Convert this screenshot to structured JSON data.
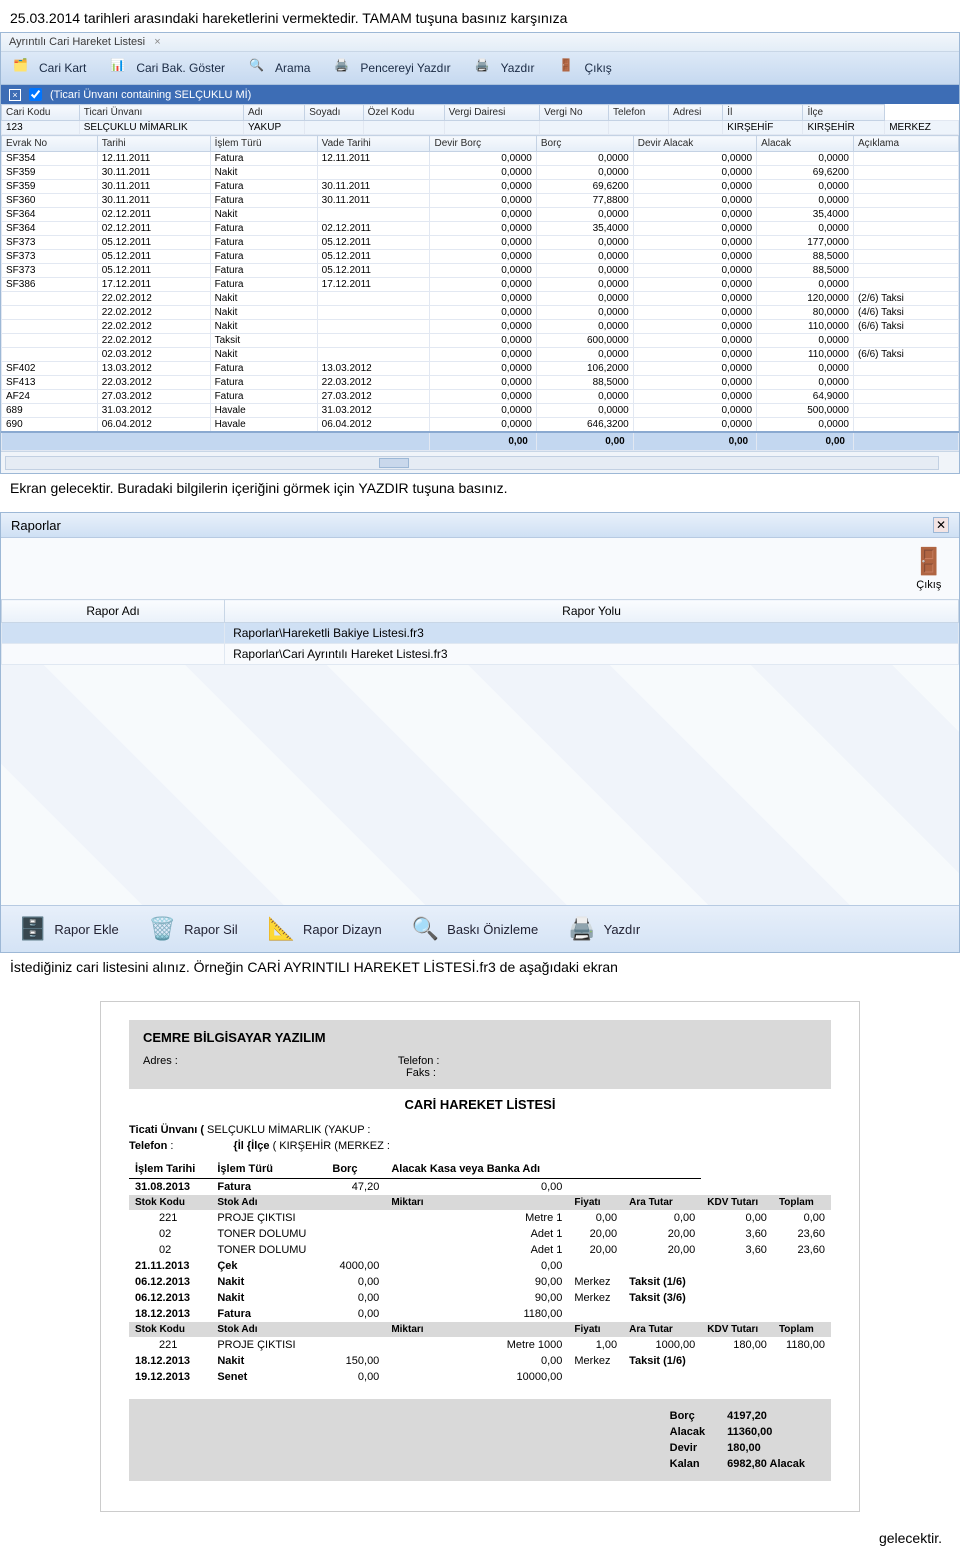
{
  "para_top": "25.03.2014 tarihleri arasındaki hareketlerini vermektedir. TAMAM tuşuna basınız karşınıza",
  "app1": {
    "tab_title": "Ayrıntılı Cari Hareket Listesi",
    "toolbar": {
      "btn1": "Cari Kart",
      "btn2": "Cari Bak. Göster",
      "btn3": "Arama",
      "btn4": "Pencereyi Yazdır",
      "btn5": "Yazdır",
      "btn6": "Çıkış"
    },
    "filter": "(Ticari Ünvanı containing SELÇUKLU Mİ)",
    "cols_top": [
      "Cari Kodu",
      "Ticari Ünvanı",
      "Adı",
      "Soyadı",
      "Özel Kodu",
      "Vergi Dairesi",
      "Vergi No",
      "Telefon",
      "Adresi",
      "İl",
      "İlçe"
    ],
    "row_top": [
      "123",
      "SELÇUKLU MİMARLIK",
      "YAKUP",
      "",
      "",
      "",
      "",
      "",
      "",
      "KIRŞEHİF",
      "KIRŞEHİR",
      "MERKEZ"
    ],
    "cols_det": [
      "Evrak No",
      "Tarihi",
      "İşlem Türü",
      "Vade Tarihi",
      "Devir Borç",
      "Borç",
      "Devir Alacak",
      "Alacak",
      "Açıklama"
    ],
    "rows": [
      [
        "SF354",
        "12.11.2011",
        "Fatura",
        "12.11.2011",
        "0,0000",
        "0,0000",
        "0,0000",
        "0,0000",
        ""
      ],
      [
        "SF359",
        "30.11.2011",
        "Nakit",
        "",
        "0,0000",
        "0,0000",
        "0,0000",
        "69,6200",
        ""
      ],
      [
        "SF359",
        "30.11.2011",
        "Fatura",
        "30.11.2011",
        "0,0000",
        "69,6200",
        "0,0000",
        "0,0000",
        ""
      ],
      [
        "SF360",
        "30.11.2011",
        "Fatura",
        "30.11.2011",
        "0,0000",
        "77,8800",
        "0,0000",
        "0,0000",
        ""
      ],
      [
        "SF364",
        "02.12.2011",
        "Nakit",
        "",
        "0,0000",
        "0,0000",
        "0,0000",
        "35,4000",
        ""
      ],
      [
        "SF364",
        "02.12.2011",
        "Fatura",
        "02.12.2011",
        "0,0000",
        "35,4000",
        "0,0000",
        "0,0000",
        ""
      ],
      [
        "SF373",
        "05.12.2011",
        "Fatura",
        "05.12.2011",
        "0,0000",
        "0,0000",
        "0,0000",
        "177,0000",
        ""
      ],
      [
        "SF373",
        "05.12.2011",
        "Fatura",
        "05.12.2011",
        "0,0000",
        "0,0000",
        "0,0000",
        "88,5000",
        ""
      ],
      [
        "SF373",
        "05.12.2011",
        "Fatura",
        "05.12.2011",
        "0,0000",
        "0,0000",
        "0,0000",
        "88,5000",
        ""
      ],
      [
        "SF386",
        "17.12.2011",
        "Fatura",
        "17.12.2011",
        "0,0000",
        "0,0000",
        "0,0000",
        "0,0000",
        ""
      ],
      [
        "",
        "22.02.2012",
        "Nakit",
        "",
        "0,0000",
        "0,0000",
        "0,0000",
        "120,0000",
        "(2/6) Taksi"
      ],
      [
        "",
        "22.02.2012",
        "Nakit",
        "",
        "0,0000",
        "0,0000",
        "0,0000",
        "80,0000",
        "(4/6) Taksi"
      ],
      [
        "",
        "22.02.2012",
        "Nakit",
        "",
        "0,0000",
        "0,0000",
        "0,0000",
        "110,0000",
        "(6/6) Taksi"
      ],
      [
        "",
        "22.02.2012",
        "Taksit",
        "",
        "0,0000",
        "600,0000",
        "0,0000",
        "0,0000",
        ""
      ],
      [
        "",
        "02.03.2012",
        "Nakit",
        "",
        "0,0000",
        "0,0000",
        "0,0000",
        "110,0000",
        "(6/6) Taksi"
      ],
      [
        "SF402",
        "13.03.2012",
        "Fatura",
        "13.03.2012",
        "0,0000",
        "106,2000",
        "0,0000",
        "0,0000",
        ""
      ],
      [
        "SF413",
        "22.03.2012",
        "Fatura",
        "22.03.2012",
        "0,0000",
        "88,5000",
        "0,0000",
        "0,0000",
        ""
      ],
      [
        "AF24",
        "27.03.2012",
        "Fatura",
        "27.03.2012",
        "0,0000",
        "0,0000",
        "0,0000",
        "64,9000",
        ""
      ],
      [
        "689",
        "31.03.2012",
        "Havale",
        "31.03.2012",
        "0,0000",
        "0,0000",
        "0,0000",
        "500,0000",
        ""
      ],
      [
        "690",
        "06.04.2012",
        "Havale",
        "06.04.2012",
        "0,0000",
        "646,3200",
        "0,0000",
        "0,0000",
        ""
      ]
    ],
    "footer": [
      "0,00",
      "0,00",
      "0,00",
      "0,00"
    ]
  },
  "para_mid": "Ekran gelecektir. Buradaki bilgilerin içeriğini görmek için YAZDIR tuşuna basınız.",
  "dlg": {
    "title": "Raporlar",
    "exit_label": "Çıkış",
    "cols": [
      "Rapor Adı",
      "Rapor Yolu"
    ],
    "rows": [
      [
        "",
        "Raporlar\\Hareketli Bakiye Listesi.fr3"
      ],
      [
        "",
        "Raporlar\\Cari Ayrıntılı Hareket Listesi.fr3"
      ]
    ],
    "buttons": [
      "Rapor Ekle",
      "Rapor Sil",
      "Rapor Dizayn",
      "Baskı Önizleme",
      "Yazdır"
    ]
  },
  "para_bot": "İstediğiniz cari listesini alınız. Örneğin CARİ AYRINTILI HAREKET LİSTESİ.fr3 de aşağıdaki ekran",
  "report": {
    "company": "CEMRE BİLGİSAYAR YAZILIM",
    "hdr_labels": {
      "adres": "Adres :",
      "tel": "Telefon :",
      "faks": "Faks :"
    },
    "title": "CARİ HAREKET LİSTESİ",
    "meta1_label": "Ticati Ünvanı (",
    "meta1_val": "SELÇUKLU MİMARLIK  (YAKUP :",
    "meta2_label": "Telefon",
    "meta2_sep": ":",
    "meta2_label2": "{İl {İlçe",
    "meta2_val2": "( KIRŞEHİR  (MERKEZ :",
    "main_cols": [
      "İşlem Tarihi",
      "İşlem Türü",
      "Borç",
      "Alacak Kasa veya Banka Adı"
    ],
    "sub_cols": [
      "Stok Kodu",
      "Stok Adı",
      "",
      "Miktarı",
      "Fiyatı",
      "Ara Tutar",
      "KDV Tutarı",
      "Toplam"
    ],
    "lines": [
      {
        "t": "main",
        "c": [
          "31.08.2013",
          "Fatura",
          "47,20",
          "0,00",
          ""
        ]
      },
      {
        "t": "subhdr"
      },
      {
        "t": "sub",
        "c": [
          "221",
          "PROJE ÇIKTISI",
          "",
          "Metre  1",
          "0,00",
          "0,00",
          "0,00",
          "0,00"
        ]
      },
      {
        "t": "sub",
        "c": [
          "02",
          "TONER DOLUMU",
          "",
          "Adet  1",
          "20,00",
          "20,00",
          "3,60",
          "23,60"
        ]
      },
      {
        "t": "sub",
        "c": [
          "02",
          "TONER DOLUMU",
          "",
          "Adet  1",
          "20,00",
          "20,00",
          "3,60",
          "23,60"
        ]
      },
      {
        "t": "main",
        "c": [
          "21.11.2013",
          "Çek",
          "4000,00",
          "0,00",
          ""
        ]
      },
      {
        "t": "main",
        "c": [
          "06.12.2013",
          "Nakit",
          "0,00",
          "90,00",
          "Merkez",
          "Taksit (1/6)"
        ]
      },
      {
        "t": "main",
        "c": [
          "06.12.2013",
          "Nakit",
          "0,00",
          "90,00",
          "Merkez",
          "Taksit (3/6)"
        ]
      },
      {
        "t": "main",
        "c": [
          "18.12.2013",
          "Fatura",
          "0,00",
          "1180,00",
          ""
        ]
      },
      {
        "t": "subhdr"
      },
      {
        "t": "sub",
        "c": [
          "221",
          "PROJE ÇIKTISI",
          "",
          "Metre  1000",
          "1,00",
          "1000,00",
          "180,00",
          "1180,00"
        ]
      },
      {
        "t": "main",
        "c": [
          "18.12.2013",
          "Nakit",
          "150,00",
          "0,00",
          "Merkez",
          "Taksit (1/6)"
        ]
      },
      {
        "t": "main",
        "c": [
          "19.12.2013",
          "Senet",
          "0,00",
          "10000,00",
          ""
        ]
      }
    ],
    "totals": {
      "borc_l": "Borç",
      "borc": "4197,20",
      "alacak_l": "Alacak",
      "alacak": "11360,00",
      "devir_l": "Devir",
      "devir": "180,00",
      "kalan_l": "Kalan",
      "kalan": "6982,80 Alacak"
    }
  },
  "trail": "gelecektir."
}
